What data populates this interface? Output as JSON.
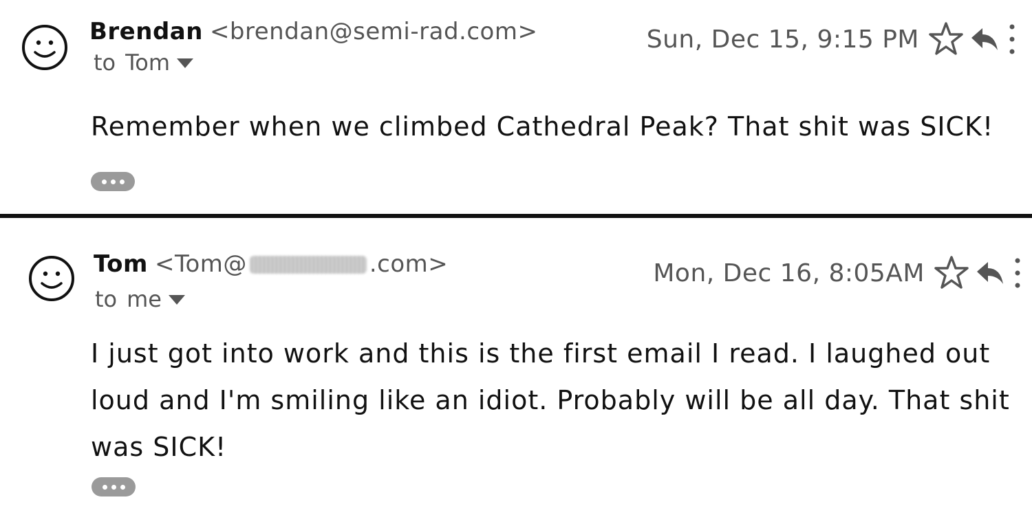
{
  "emails": [
    {
      "sender_name": "Brendan",
      "sender_email": "<brendan@semi-rad.com>",
      "recipient_label": "to",
      "recipient": "Tom",
      "timestamp": "Sun, Dec 15, 9:15 PM",
      "body": "Remember when we climbed Cathedral Peak? That shit was SICK!"
    },
    {
      "sender_name": "Tom",
      "sender_email_prefix": "<Tom@",
      "sender_email_suffix": ".com>",
      "recipient_label": "to",
      "recipient": "me",
      "timestamp": "Mon, Dec 16, 8:05AM",
      "body": "I just got into work and this is the first email I read. I laughed out loud and I'm smiling like an idiot. Probably will be all day. That shit was SICK!"
    }
  ],
  "icons": {
    "avatar": "smiley-face-icon",
    "star": "star-icon",
    "reply": "reply-arrow-icon",
    "more": "vertical-ellipsis-icon",
    "expand": "ellipsis-pill-icon"
  },
  "colors": {
    "text": "#111111",
    "muted": "#555555",
    "pill": "#9a9a9a",
    "divider": "#111111"
  }
}
